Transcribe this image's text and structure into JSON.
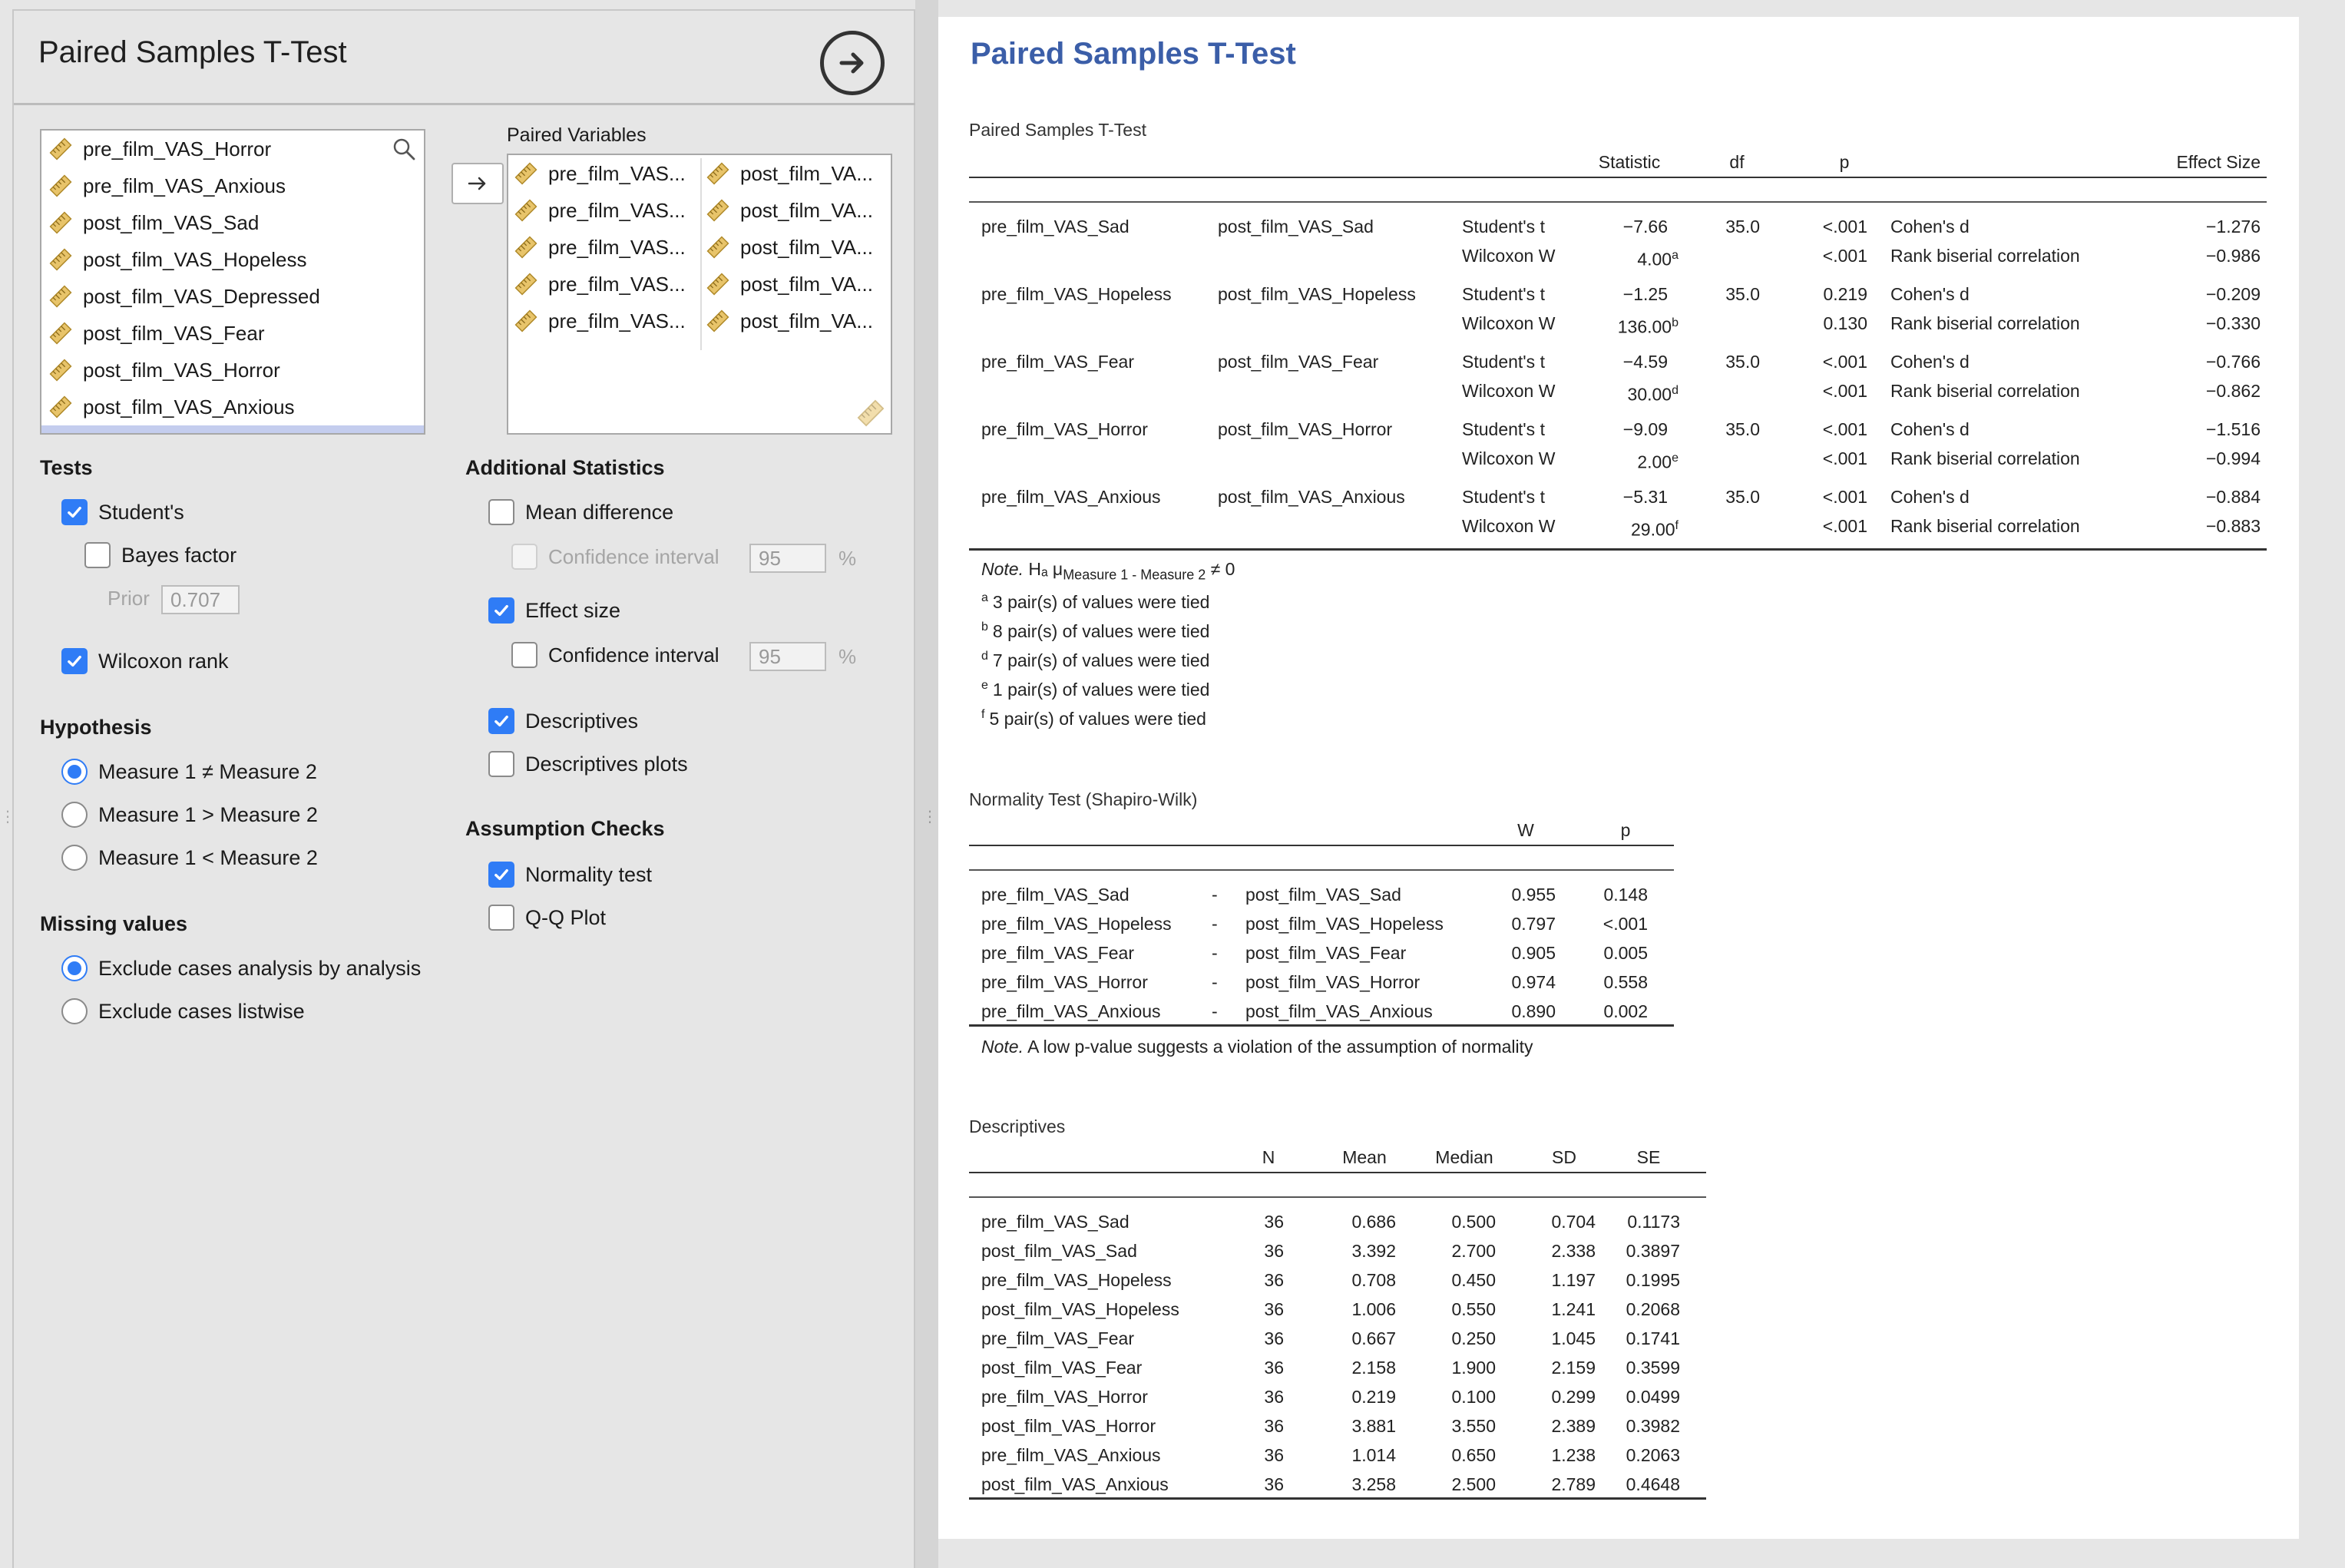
{
  "panel": {
    "title": "Paired Samples T-Test",
    "variables": [
      "pre_film_VAS_Horror",
      "pre_film_VAS_Anxious",
      "post_film_VAS_Sad",
      "post_film_VAS_Hopeless",
      "post_film_VAS_Depressed",
      "post_film_VAS_Fear",
      "post_film_VAS_Horror",
      "post_film_VAS_Anxious"
    ],
    "paired_label": "Paired Variables",
    "paired_left": [
      "pre_film_VAS...",
      "pre_film_VAS...",
      "pre_film_VAS...",
      "pre_film_VAS...",
      "pre_film_VAS..."
    ],
    "paired_right": [
      "post_film_VA...",
      "post_film_VA...",
      "post_film_VA...",
      "post_film_VA...",
      "post_film_VA..."
    ],
    "tests": {
      "heading": "Tests",
      "students": "Student's",
      "bayes": "Bayes factor",
      "prior_label": "Prior",
      "prior_value": "0.707",
      "wilcoxon": "Wilcoxon rank"
    },
    "hypothesis": {
      "heading": "Hypothesis",
      "options": [
        "Measure 1 ≠ Measure 2",
        "Measure 1 > Measure 2",
        "Measure 1 < Measure 2"
      ]
    },
    "missing": {
      "heading": "Missing values",
      "options": [
        "Exclude cases analysis by analysis",
        "Exclude cases listwise"
      ]
    },
    "additional": {
      "heading": "Additional Statistics",
      "mean_diff": "Mean difference",
      "ci_label": "Confidence interval",
      "ci_value": "95",
      "pct": "%",
      "effect_size": "Effect size",
      "ci2_label": "Confidence interval",
      "ci2_value": "95",
      "descriptives": "Descriptives",
      "desc_plots": "Descriptives plots"
    },
    "assumptions": {
      "heading": "Assumption Checks",
      "normality": "Normality test",
      "qq": "Q-Q Plot"
    }
  },
  "output": {
    "title": "Paired Samples T-Test",
    "ttest": {
      "caption": "Paired Samples T-Test",
      "headers": {
        "statistic": "Statistic",
        "df": "df",
        "p": "p",
        "effect": "Effect Size"
      },
      "rows": [
        {
          "m1": "pre_film_VAS_Sad",
          "m2": "post_film_VAS_Sad",
          "t1": "Student's t",
          "s1": "−7.66",
          "df": "35.0",
          "p1": "<.001",
          "e1": "Cohen's d",
          "v1": "−1.276",
          "t2": "Wilcoxon W",
          "s2": "4.00",
          "sup": "a",
          "p2": "<.001",
          "e2": "Rank biserial correlation",
          "v2": "−0.986"
        },
        {
          "m1": "pre_film_VAS_Hopeless",
          "m2": "post_film_VAS_Hopeless",
          "t1": "Student's t",
          "s1": "−1.25",
          "df": "35.0",
          "p1": "0.219",
          "e1": "Cohen's d",
          "v1": "−0.209",
          "t2": "Wilcoxon W",
          "s2": "136.00",
          "sup": "b",
          "p2": "0.130",
          "e2": "Rank biserial correlation",
          "v2": "−0.330"
        },
        {
          "m1": "pre_film_VAS_Fear",
          "m2": "post_film_VAS_Fear",
          "t1": "Student's t",
          "s1": "−4.59",
          "df": "35.0",
          "p1": "<.001",
          "e1": "Cohen's d",
          "v1": "−0.766",
          "t2": "Wilcoxon W",
          "s2": "30.00",
          "sup": "d",
          "p2": "<.001",
          "e2": "Rank biserial correlation",
          "v2": "−0.862"
        },
        {
          "m1": "pre_film_VAS_Horror",
          "m2": "post_film_VAS_Horror",
          "t1": "Student's t",
          "s1": "−9.09",
          "df": "35.0",
          "p1": "<.001",
          "e1": "Cohen's d",
          "v1": "−1.516",
          "t2": "Wilcoxon W",
          "s2": "2.00",
          "sup": "e",
          "p2": "<.001",
          "e2": "Rank biserial correlation",
          "v2": "−0.994"
        },
        {
          "m1": "pre_film_VAS_Anxious",
          "m2": "post_film_VAS_Anxious",
          "t1": "Student's t",
          "s1": "−5.31",
          "df": "35.0",
          "p1": "<.001",
          "e1": "Cohen's d",
          "v1": "−0.884",
          "t2": "Wilcoxon W",
          "s2": "29.00",
          "sup": "f",
          "p2": "<.001",
          "e2": "Rank biserial correlation",
          "v2": "−0.883"
        }
      ],
      "note_prefix": "Note.",
      "note_h": "Hₐ μ",
      "note_sub": "Measure 1 - Measure 2",
      "note_ne": " ≠ 0",
      "footnotes": [
        {
          "mark": "a",
          "text": "3 pair(s) of values were tied"
        },
        {
          "mark": "b",
          "text": "8 pair(s) of values were tied"
        },
        {
          "mark": "d",
          "text": "7 pair(s) of values were tied"
        },
        {
          "mark": "e",
          "text": "1 pair(s) of values were tied"
        },
        {
          "mark": "f",
          "text": "5 pair(s) of values were tied"
        }
      ]
    },
    "normality": {
      "caption": "Normality Test (Shapiro-Wilk)",
      "headers": {
        "w": "W",
        "p": "p"
      },
      "rows": [
        {
          "a": "pre_film_VAS_Sad",
          "dash": "-",
          "b": "post_film_VAS_Sad",
          "w": "0.955",
          "p": "0.148"
        },
        {
          "a": "pre_film_VAS_Hopeless",
          "dash": "-",
          "b": "post_film_VAS_Hopeless",
          "w": "0.797",
          "p": "<.001"
        },
        {
          "a": "pre_film_VAS_Fear",
          "dash": "-",
          "b": "post_film_VAS_Fear",
          "w": "0.905",
          "p": "0.005"
        },
        {
          "a": "pre_film_VAS_Horror",
          "dash": "-",
          "b": "post_film_VAS_Horror",
          "w": "0.974",
          "p": "0.558"
        },
        {
          "a": "pre_film_VAS_Anxious",
          "dash": "-",
          "b": "post_film_VAS_Anxious",
          "w": "0.890",
          "p": "0.002"
        }
      ],
      "note_prefix": "Note.",
      "note": "A low p-value suggests a violation of the assumption of normality"
    },
    "descriptives": {
      "caption": "Descriptives",
      "headers": [
        "N",
        "Mean",
        "Median",
        "SD",
        "SE"
      ],
      "rows": [
        {
          "name": "pre_film_VAS_Sad",
          "n": "36",
          "mean": "0.686",
          "median": "0.500",
          "sd": "0.704",
          "se": "0.1173"
        },
        {
          "name": "post_film_VAS_Sad",
          "n": "36",
          "mean": "3.392",
          "median": "2.700",
          "sd": "2.338",
          "se": "0.3897"
        },
        {
          "name": "pre_film_VAS_Hopeless",
          "n": "36",
          "mean": "0.708",
          "median": "0.450",
          "sd": "1.197",
          "se": "0.1995"
        },
        {
          "name": "post_film_VAS_Hopeless",
          "n": "36",
          "mean": "1.006",
          "median": "0.550",
          "sd": "1.241",
          "se": "0.2068"
        },
        {
          "name": "pre_film_VAS_Fear",
          "n": "36",
          "mean": "0.667",
          "median": "0.250",
          "sd": "1.045",
          "se": "0.1741"
        },
        {
          "name": "post_film_VAS_Fear",
          "n": "36",
          "mean": "2.158",
          "median": "1.900",
          "sd": "2.159",
          "se": "0.3599"
        },
        {
          "name": "pre_film_VAS_Horror",
          "n": "36",
          "mean": "0.219",
          "median": "0.100",
          "sd": "0.299",
          "se": "0.0499"
        },
        {
          "name": "post_film_VAS_Horror",
          "n": "36",
          "mean": "3.881",
          "median": "3.550",
          "sd": "2.389",
          "se": "0.3982"
        },
        {
          "name": "pre_film_VAS_Anxious",
          "n": "36",
          "mean": "1.014",
          "median": "0.650",
          "sd": "1.238",
          "se": "0.2063"
        },
        {
          "name": "post_film_VAS_Anxious",
          "n": "36",
          "mean": "3.258",
          "median": "2.500",
          "sd": "2.789",
          "se": "0.4648"
        }
      ]
    }
  }
}
